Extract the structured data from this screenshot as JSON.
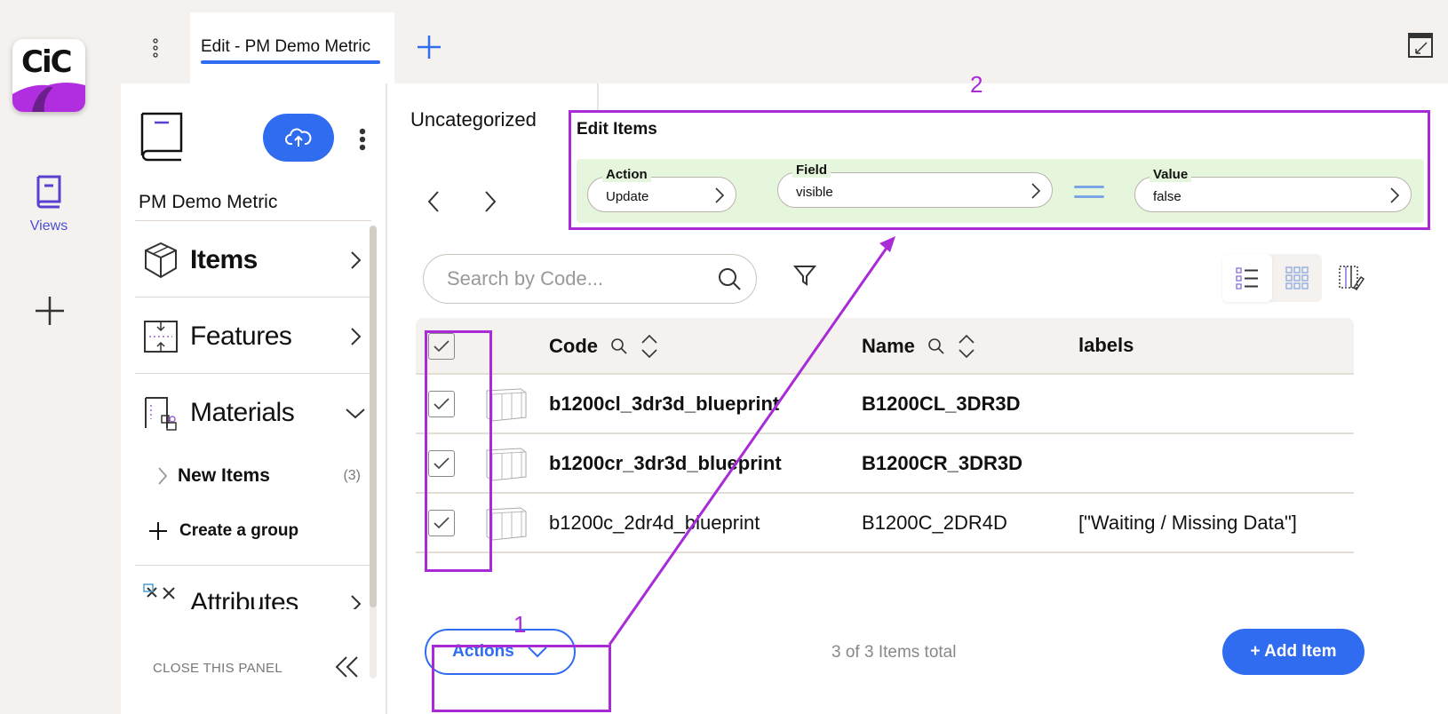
{
  "rail": {
    "logo_text": "CiC",
    "views_label": "Views"
  },
  "tabs": {
    "active_label": "Edit - PM Demo Metric"
  },
  "panel": {
    "project_name": "PM Demo Metric",
    "nav": [
      {
        "label": "Items",
        "icon": "cube-icon"
      },
      {
        "label": "Features",
        "icon": "features-icon"
      },
      {
        "label": "Materials",
        "icon": "materials-icon"
      },
      {
        "label": "Attributes",
        "icon": "attributes-icon"
      }
    ],
    "sub_item": {
      "label": "New Items",
      "count": "(3)"
    },
    "create_group": "Create a group",
    "close_panel": "CLOSE THIS PANEL"
  },
  "content": {
    "group_tab": "Uncategorized",
    "search_placeholder": "Search by Code...",
    "columns": {
      "code": "Code",
      "name": "Name",
      "labels": "labels"
    },
    "rows": [
      {
        "code": "b1200cl_3dr3d_blueprint",
        "name": "B1200CL_3DR3D",
        "labels": "",
        "checked": true
      },
      {
        "code": "b1200cr_3dr3d_blueprint",
        "name": "B1200CR_3DR3D",
        "labels": "",
        "checked": true
      },
      {
        "code": "b1200c_2dr4d_blueprint",
        "name": "B1200C_2DR4D",
        "labels": "[\"Waiting / Missing Data\"]",
        "checked": true
      }
    ],
    "actions_label": "Actions",
    "total_text": "3 of 3 Items total",
    "add_item_label": "+ Add Item"
  },
  "edit_items": {
    "title": "Edit Items",
    "action": {
      "legend": "Action",
      "value": "Update"
    },
    "field": {
      "legend": "Field",
      "value": "visible"
    },
    "value": {
      "legend": "Value",
      "value": "false"
    }
  },
  "annotations": {
    "step1": "1",
    "step2": "2"
  },
  "colors": {
    "accent": "#2f6cf0",
    "annotation": "#a92bd6",
    "brand_purple": "#b12ee0",
    "edit_band": "#e6f6dc"
  }
}
